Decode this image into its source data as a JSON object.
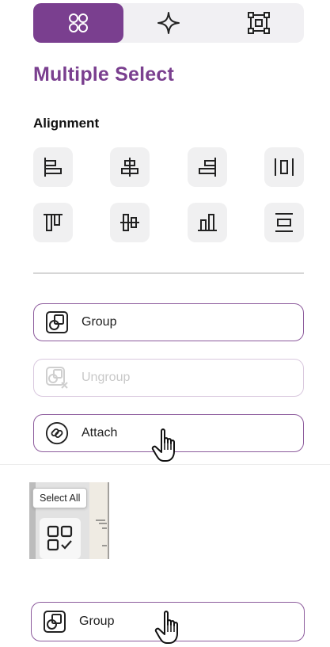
{
  "panel": {
    "title": "Multiple Select",
    "alignment_heading": "Alignment"
  },
  "tabs": [
    {
      "icon": "grid-circles-icon",
      "active": true
    },
    {
      "icon": "sparkle-icon",
      "active": false
    },
    {
      "icon": "frame-select-icon",
      "active": false
    }
  ],
  "alignment_buttons": [
    "align-left-icon",
    "align-center-horizontal-icon",
    "align-right-icon",
    "distribute-horizontal-icon",
    "align-top-icon",
    "align-center-vertical-icon",
    "align-bottom-icon",
    "distribute-vertical-icon"
  ],
  "actions": {
    "group": "Group",
    "ungroup": "Ungroup",
    "attach": "Attach"
  },
  "tooltip": {
    "select_all": "Select All"
  },
  "bottom_action": {
    "group": "Group"
  },
  "colors": {
    "accent": "#7a3f8f",
    "button_bg": "#f0f0f1",
    "border": "#8c5a9c"
  }
}
